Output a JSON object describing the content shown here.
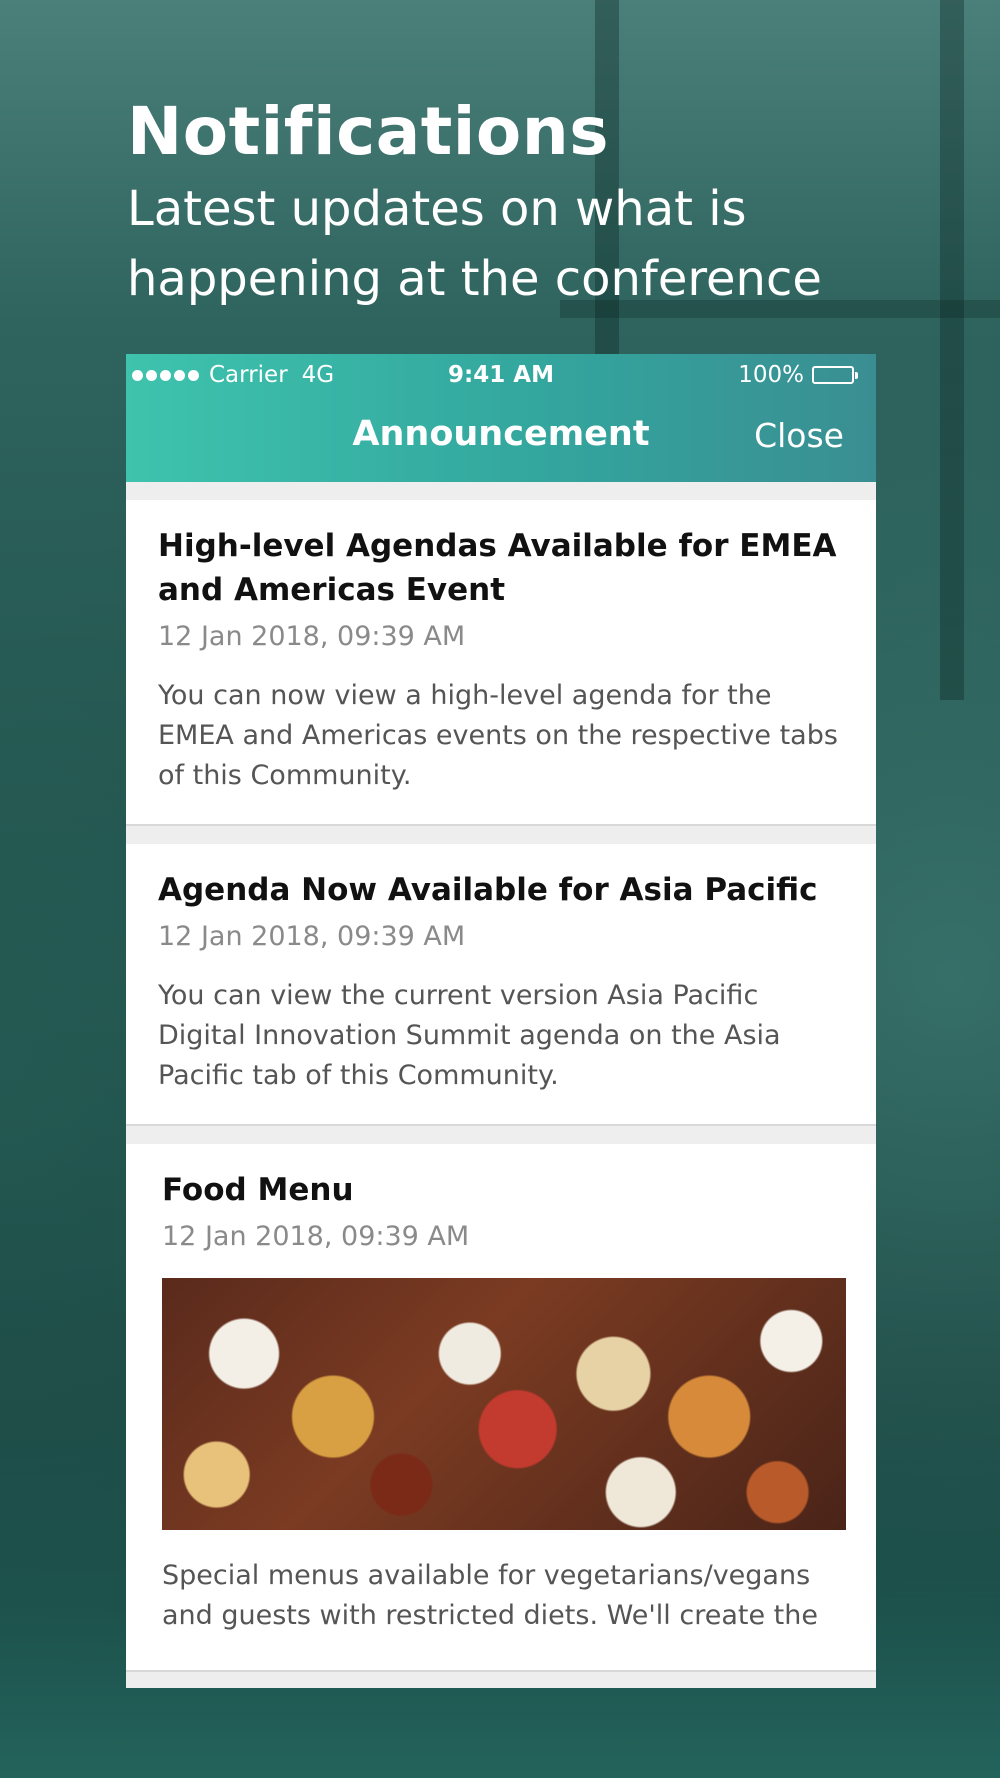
{
  "hero": {
    "title": "Notifications",
    "subtitle_line1": "Latest updates on what is",
    "subtitle_line2": "happening at the conference"
  },
  "status_bar": {
    "carrier": "Carrier",
    "network": "4G",
    "time": "9:41 AM",
    "battery": "100%"
  },
  "nav": {
    "title": "Announcement",
    "close_label": "Close"
  },
  "announcements": [
    {
      "title": "High-level Agendas Available for EMEA and Americas Event",
      "date": "12 Jan 2018, 09:39 AM",
      "body": "You can now view a high-level agenda for the EMEA and Americas events on the respective tabs of this Community."
    },
    {
      "title": "Agenda Now Available for Asia Pacific",
      "date": "12 Jan 2018, 09:39 AM",
      "body": "You can view the current version Asia Pacific Digital Innovation Summit agenda on the Asia Pacific tab of this Community."
    },
    {
      "title": "Food Menu",
      "date": "12 Jan 2018, 09:39 AM",
      "image": "food-photo",
      "body": "Special menus available for vegetarians/vegans and guests with restricted diets. We'll create the"
    }
  ]
}
